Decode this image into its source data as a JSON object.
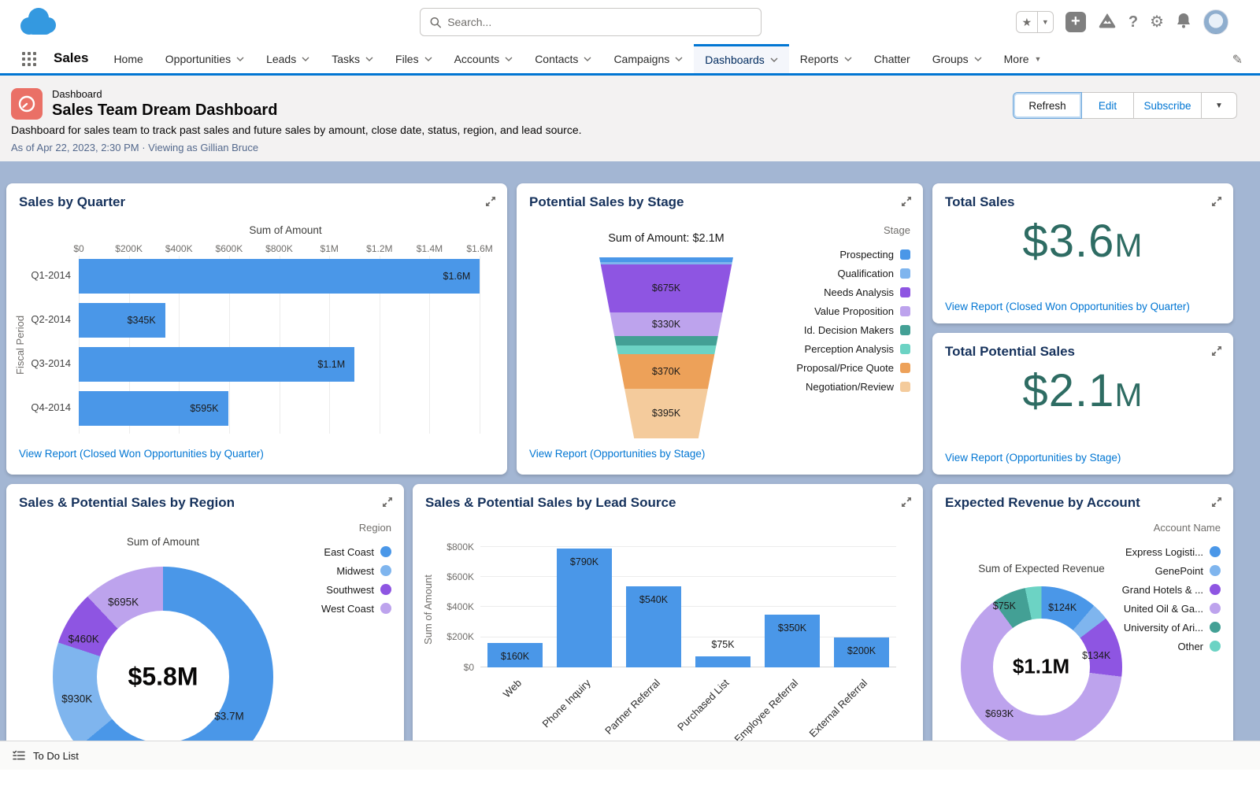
{
  "global_nav": {
    "search_placeholder": "Search...",
    "app_name": "Sales",
    "tabs": [
      {
        "label": "Home"
      },
      {
        "label": "Opportunities"
      },
      {
        "label": "Leads"
      },
      {
        "label": "Tasks"
      },
      {
        "label": "Files"
      },
      {
        "label": "Accounts"
      },
      {
        "label": "Contacts"
      },
      {
        "label": "Campaigns"
      },
      {
        "label": "Dashboards"
      },
      {
        "label": "Reports"
      },
      {
        "label": "Chatter"
      },
      {
        "label": "Groups"
      },
      {
        "label": "More"
      }
    ],
    "selected_tab": "Dashboards"
  },
  "page_header": {
    "entity_label": "Dashboard",
    "title": "Sales Team Dream Dashboard",
    "description": "Dashboard for sales team to track past sales and future sales by amount, close date, status, region, and lead source.",
    "meta": "As of Apr 22, 2023, 2:30 PM · Viewing as Gillian Bruce",
    "buttons": {
      "refresh": "Refresh",
      "edit": "Edit",
      "subscribe": "Subscribe"
    }
  },
  "footer": {
    "todo": "To Do List"
  },
  "colors": {
    "blue": "#4A97E8",
    "light_blue": "#7FB5EE",
    "purple": "#8E55E2",
    "light_purple": "#BDA3ED",
    "teal": "#43A095",
    "light_teal": "#6CD3C4",
    "orange": "#EDA159",
    "light_orange": "#F4CB9C",
    "metric": "#2E6C63",
    "link": "#0176D3",
    "brand": "#0176D3"
  },
  "cards": {
    "sales_by_quarter": {
      "title": "Sales by Quarter",
      "axis_title": "Sum of Amount",
      "y_axis_label": "Fiscal Period",
      "x_ticks": [
        "$0",
        "$200K",
        "$400K",
        "$600K",
        "$800K",
        "$1M",
        "$1.2M",
        "$1.4M",
        "$1.6M"
      ],
      "bars": [
        {
          "label": "Q1-2014",
          "value": 1600000,
          "value_label": "$1.6M",
          "pct": 97.0
        },
        {
          "label": "Q2-2014",
          "value": 345000,
          "value_label": "$345K",
          "pct": 20.9
        },
        {
          "label": "Q3-2014",
          "value": 1100000,
          "value_label": "$1.1M",
          "pct": 66.7
        },
        {
          "label": "Q4-2014",
          "value": 595000,
          "value_label": "$595K",
          "pct": 36.1
        }
      ],
      "link": "View Report (Closed Won Opportunities by Quarter)"
    },
    "potential_by_stage": {
      "title": "Potential Sales by Stage",
      "subtitle": "Sum of Amount: $2.1M",
      "legend_title": "Stage",
      "stages": [
        {
          "label": "Prospecting",
          "color": "#4A97E8",
          "value": 30000,
          "value_label": "",
          "h_pct": 2.7
        },
        {
          "label": "Qualification",
          "color": "#7FB5EE",
          "value": 15000,
          "value_label": "",
          "h_pct": 1.1
        },
        {
          "label": "Needs Analysis",
          "color": "#8E55E2",
          "value": 675000,
          "value_label": "$675K",
          "h_pct": 26.6
        },
        {
          "label": "Value Proposition",
          "color": "#BDA3ED",
          "value": 330000,
          "value_label": "$330K",
          "h_pct": 13.3
        },
        {
          "label": "Id. Decision Makers",
          "color": "#43A095",
          "value": 75000,
          "value_label": "",
          "h_pct": 4.9
        },
        {
          "label": "Perception Analysis",
          "color": "#6CD3C4",
          "value": 75000,
          "value_label": "",
          "h_pct": 4.9
        },
        {
          "label": "Proposal/Price Quote",
          "color": "#EDA159",
          "value": 370000,
          "value_label": "$370K",
          "h_pct": 19.0
        },
        {
          "label": "Negotiation/Review",
          "color": "#F4CB9C",
          "value": 395000,
          "value_label": "$395K",
          "h_pct": 27.5
        }
      ],
      "link": "View Report (Opportunities by Stage)"
    },
    "total_sales": {
      "title": "Total Sales",
      "value": "$3.6",
      "unit": "M",
      "link": "View Report (Closed Won Opportunities by Quarter)"
    },
    "total_potential": {
      "title": "Total Potential Sales",
      "value": "$2.1",
      "unit": "M",
      "link": "View Report (Opportunities by Stage)"
    },
    "by_region": {
      "title": "Sales & Potential Sales by Region",
      "axis_title": "Sum of Amount",
      "legend_title": "Region",
      "center_label": "$5.8M",
      "segments": [
        {
          "label": "East Coast",
          "color": "#4A97E8",
          "value": 3700000,
          "value_label": "$3.7M"
        },
        {
          "label": "Midwest",
          "color": "#7FB5EE",
          "value": 930000,
          "value_label": "$930K"
        },
        {
          "label": "Southwest",
          "color": "#8E55E2",
          "value": 460000,
          "value_label": "$460K"
        },
        {
          "label": "West Coast",
          "color": "#BDA3ED",
          "value": 695000,
          "value_label": "$695K"
        }
      ]
    },
    "by_lead_source": {
      "title": "Sales & Potential Sales by Lead Source",
      "y_axis_label": "Sum of Amount",
      "y_ticks": [
        "$800K",
        "$600K",
        "$400K",
        "$200K",
        "$0"
      ],
      "bars": [
        {
          "label": "Web",
          "value": 160000,
          "value_label": "$160K",
          "pct": 18.8
        },
        {
          "label": "Phone Inquiry",
          "value": 790000,
          "value_label": "$790K",
          "pct": 92.9
        },
        {
          "label": "Partner Referral",
          "value": 540000,
          "value_label": "$540K",
          "pct": 63.5
        },
        {
          "label": "Purchased List",
          "value": 75000,
          "value_label": "$75K",
          "pct": 8.8
        },
        {
          "label": "Employee Referral",
          "value": 350000,
          "value_label": "$350K",
          "pct": 41.2
        },
        {
          "label": "External Referral",
          "value": 200000,
          "value_label": "$200K",
          "pct": 23.5
        }
      ]
    },
    "by_account": {
      "title": "Expected Revenue by Account",
      "axis_title": "Sum of Expected Revenue",
      "legend_title": "Account Name",
      "center_label": "$1.1M",
      "segments": [
        {
          "label": "Express Logisti...",
          "color": "#4A97E8",
          "value": 124000,
          "value_label": "$124K"
        },
        {
          "label": "GenePoint",
          "color": "#7FB5EE",
          "value": 38000,
          "value_label": ""
        },
        {
          "label": "Grand Hotels & ...",
          "color": "#8E55E2",
          "value": 134000,
          "value_label": "$134K"
        },
        {
          "label": "United Oil & Ga...",
          "color": "#BDA3ED",
          "value": 693000,
          "value_label": "$693K"
        },
        {
          "label": "University of Ari...",
          "color": "#43A095",
          "value": 75000,
          "value_label": "$75K"
        },
        {
          "label": "Other",
          "color": "#6CD3C4",
          "value": 36000,
          "value_label": ""
        }
      ]
    }
  },
  "chart_data": [
    {
      "type": "bar",
      "title": "Sales by Quarter",
      "xlabel": "Sum of Amount",
      "ylabel": "Fiscal Period",
      "orientation": "horizontal",
      "categories": [
        "Q1-2014",
        "Q2-2014",
        "Q3-2014",
        "Q4-2014"
      ],
      "values": [
        1600000,
        345000,
        1100000,
        595000
      ],
      "xlim": [
        0,
        1600000
      ],
      "grid": true
    },
    {
      "type": "funnel",
      "title": "Potential Sales by Stage",
      "subtitle": "Sum of Amount: $2.1M",
      "categories": [
        "Prospecting",
        "Qualification",
        "Needs Analysis",
        "Value Proposition",
        "Id. Decision Makers",
        "Perception Analysis",
        "Proposal/Price Quote",
        "Negotiation/Review"
      ],
      "values": [
        30000,
        15000,
        675000,
        330000,
        75000,
        75000,
        370000,
        395000
      ],
      "legend_position": "right"
    },
    {
      "type": "metric",
      "title": "Total Sales",
      "value": 3600000,
      "display": "$3.6M"
    },
    {
      "type": "metric",
      "title": "Total Potential Sales",
      "value": 2100000,
      "display": "$2.1M"
    },
    {
      "type": "pie",
      "title": "Sales & Potential Sales by Region",
      "subtitle": "Sum of Amount",
      "center_total": "$5.8M",
      "categories": [
        "East Coast",
        "Midwest",
        "Southwest",
        "West Coast"
      ],
      "values": [
        3700000,
        930000,
        460000,
        695000
      ],
      "legend_position": "right"
    },
    {
      "type": "bar",
      "title": "Sales & Potential Sales by Lead Source",
      "ylabel": "Sum of Amount",
      "orientation": "vertical",
      "categories": [
        "Web",
        "Phone Inquiry",
        "Partner Referral",
        "Purchased List",
        "Employee Referral",
        "External Referral"
      ],
      "values": [
        160000,
        790000,
        540000,
        75000,
        350000,
        200000
      ],
      "ylim": [
        0,
        800000
      ],
      "grid": true
    },
    {
      "type": "pie",
      "title": "Expected Revenue by Account",
      "subtitle": "Sum of Expected Revenue",
      "center_total": "$1.1M",
      "categories": [
        "Express Logisti...",
        "GenePoint",
        "Grand Hotels & ...",
        "United Oil & Ga...",
        "University of Ari...",
        "Other"
      ],
      "values": [
        124000,
        38000,
        134000,
        693000,
        75000,
        36000
      ],
      "legend_position": "right"
    }
  ]
}
